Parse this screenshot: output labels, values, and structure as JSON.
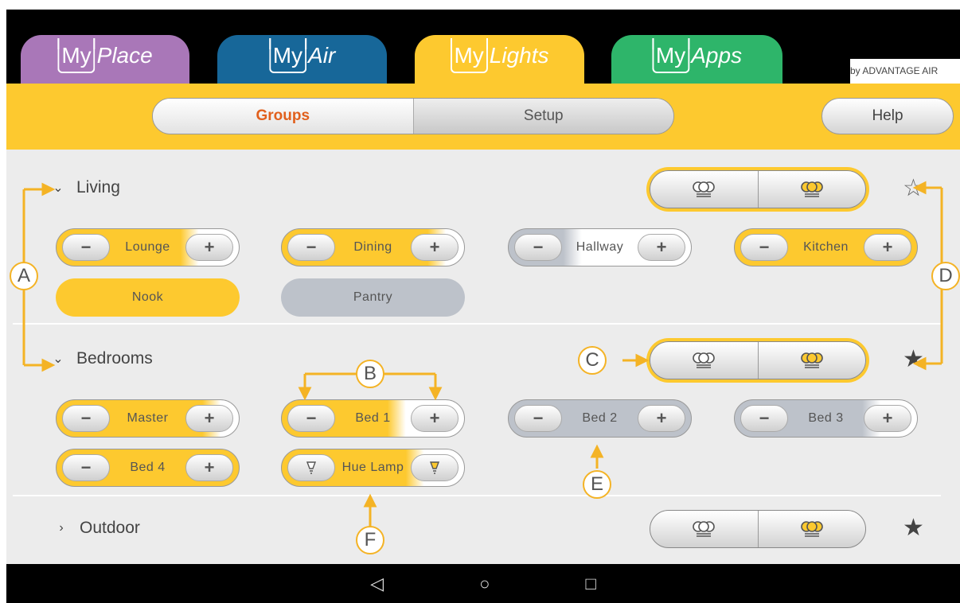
{
  "tabs": [
    {
      "my": "My",
      "brand": "Place"
    },
    {
      "my": "My",
      "brand": "Air"
    },
    {
      "my": "My",
      "brand": "Lights"
    },
    {
      "my": "My",
      "brand": "Apps"
    }
  ],
  "byline": "by ADVANTAGE AIR",
  "header": {
    "segments": [
      "Groups",
      "Setup"
    ],
    "active_segment": "Groups",
    "help_label": "Help"
  },
  "colors": {
    "brand_yellow": "#fdc92f",
    "place_purple": "#a977b8",
    "air_blue": "#176799",
    "apps_green": "#2eb56a",
    "active_orange": "#e1601d",
    "off_grey": "#bdc2ca",
    "annotation": "#f4b325"
  },
  "groups": [
    {
      "name": "Living",
      "expanded": true,
      "favourite": false,
      "lights": [
        {
          "name": "Lounge",
          "type": "dimmer",
          "level_pct": 68
        },
        {
          "name": "Dining",
          "type": "dimmer",
          "level_pct": 80
        },
        {
          "name": "Hallway",
          "type": "dimmer",
          "level_pct": 30
        },
        {
          "name": "Kitchen",
          "type": "dimmer",
          "level_pct": 100
        },
        {
          "name": "Nook",
          "type": "switch",
          "on": true
        },
        {
          "name": "Pantry",
          "type": "switch",
          "on": false
        }
      ]
    },
    {
      "name": "Bedrooms",
      "expanded": true,
      "favourite": true,
      "lights": [
        {
          "name": "Master",
          "type": "dimmer",
          "level_pct": 80
        },
        {
          "name": "Bed 1",
          "type": "dimmer",
          "level_pct": 58
        },
        {
          "name": "Bed 2",
          "type": "dimmer",
          "level_pct": 0
        },
        {
          "name": "Bed 3",
          "type": "dimmer",
          "level_pct": 70
        },
        {
          "name": "Bed 4",
          "type": "dimmer",
          "level_pct": 100
        },
        {
          "name": "Hue Lamp",
          "type": "hue",
          "level_pct": 68
        }
      ]
    },
    {
      "name": "Outdoor",
      "expanded": false,
      "favourite": true,
      "lights": []
    }
  ],
  "icons": {
    "minus": "−",
    "plus": "+",
    "chevron_down": "⌄",
    "chevron_right": "›",
    "star_empty": "☆",
    "star_filled": "★",
    "nav_back": "◁",
    "nav_home": "○",
    "nav_recent": "□"
  },
  "annotations": [
    "A",
    "B",
    "C",
    "D",
    "E",
    "F"
  ]
}
